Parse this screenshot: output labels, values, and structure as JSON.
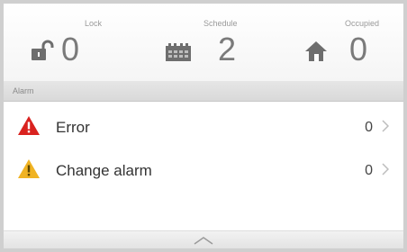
{
  "status": {
    "lock": {
      "label": "Lock",
      "value": "0",
      "icon": "padlock-icon"
    },
    "schedule": {
      "label": "Schedule",
      "value": "2",
      "icon": "calendar-icon"
    },
    "occupied": {
      "label": "Occupied",
      "value": "0",
      "icon": "home-icon"
    }
  },
  "alarm_section": {
    "title": "Alarm",
    "items": [
      {
        "label": "Error",
        "count": "0",
        "icon": "error-warning-icon",
        "color": "#d9221f"
      },
      {
        "label": "Change alarm",
        "count": "0",
        "icon": "caution-warning-icon",
        "color": "#f0b323"
      }
    ]
  },
  "footer": {
    "handle_icon": "chevron-up-icon"
  }
}
